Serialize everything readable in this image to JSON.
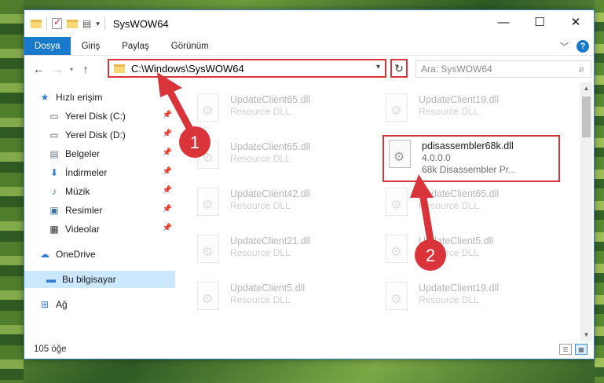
{
  "window": {
    "title": "SysWOW64",
    "controls": {
      "minimize": "—",
      "maximize": "☐",
      "close": "✕"
    }
  },
  "ribbon": {
    "tabs": [
      "Dosya",
      "Giriş",
      "Paylaş",
      "Görünüm"
    ],
    "help": "?"
  },
  "navbar": {
    "back": "←",
    "forward": "→",
    "up": "↑",
    "address": "C:\\Windows\\SysWOW64",
    "refresh": "↻",
    "search_placeholder": "Ara: SysWOW64"
  },
  "sidebar": {
    "items": [
      {
        "label": "Hızlı erişim",
        "icon": "star-icon"
      },
      {
        "label": "Yerel Disk (C:)",
        "icon": "drive-icon"
      },
      {
        "label": "Yerel Disk (D:)",
        "icon": "drive-icon"
      },
      {
        "label": "Belgeler",
        "icon": "documents-icon"
      },
      {
        "label": "İndirmeler",
        "icon": "download-icon"
      },
      {
        "label": "Müzik",
        "icon": "music-icon"
      },
      {
        "label": "Resimler",
        "icon": "pictures-icon"
      },
      {
        "label": "Videolar",
        "icon": "videos-icon"
      },
      {
        "label": "OneDrive",
        "icon": "cloud-icon"
      },
      {
        "label": "Bu bilgisayar",
        "icon": "computer-icon"
      },
      {
        "label": "Ağ",
        "icon": "network-icon"
      }
    ]
  },
  "files": [
    {
      "name": "UpdateClient65.dll",
      "type": "Resource DLL"
    },
    {
      "name": "UpdateClient19.dll",
      "type": "Resource DLL"
    },
    {
      "name": "UpdateClient65.dll",
      "type": "Resource DLL"
    },
    {
      "name": "pdisassembler68k.dll",
      "version": "4.0.0.0",
      "desc": "68k Disassembler Pr..."
    },
    {
      "name": "UpdateClient42.dll",
      "type": "Resource DLL"
    },
    {
      "name": "UpdateClient65.dll",
      "type": "Resource DLL"
    },
    {
      "name": "UpdateClient21.dll",
      "type": "Resource DLL"
    },
    {
      "name": "UpdateClient5.dll",
      "type": "Resource DLL"
    },
    {
      "name": "UpdateClient5.dll",
      "type": "Resource DLL"
    },
    {
      "name": "UpdateClient19.dll",
      "type": "Resource DLL"
    }
  ],
  "status": {
    "count": "105 öğe"
  },
  "annotations": {
    "one": "1",
    "two": "2"
  },
  "colors": {
    "accent": "#1979ca",
    "highlight": "#d9343a",
    "selection": "#cce8ff"
  }
}
